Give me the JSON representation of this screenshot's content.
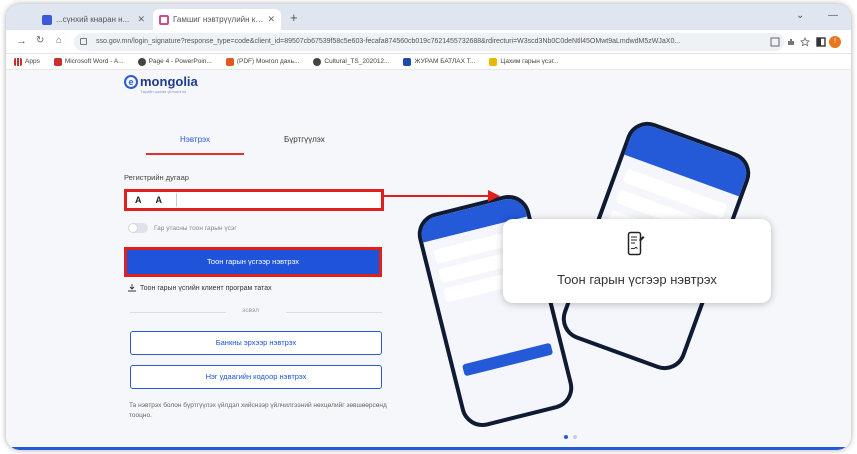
{
  "browser": {
    "tabs": [
      {
        "label": "...сүнхий кнаран н...",
        "color": "#3b5bd8"
      },
      {
        "label": "Гамшиг нэвтрүүлийн кнаран хэ...",
        "color": "#d14a8b"
      }
    ],
    "new_tab": "+",
    "window_controls": {
      "minimize": "⌄",
      "more": "—"
    },
    "url": "sso.gov.mn/login_signature?response_type=code&client_id=89507cb67539f58c5e603-fecafa874560cb019c7621455732688&rdirecturi=W3scd3Nb0C0deNtll45OMwt9aLmdwdM5zWJaX0...",
    "profile_initial": "!"
  },
  "bookmarks": [
    {
      "label": "Apps",
      "color": "#888888"
    },
    {
      "label": "Microsoft Word - A...",
      "color": "#c9302c"
    },
    {
      "label": "Page 4 - PowerPoin...",
      "color": "#444444"
    },
    {
      "label": "(PDF) Монгол дахь...",
      "color": "#e2591e"
    },
    {
      "label": "Cultural_TS_202012...",
      "color": "#444444"
    },
    {
      "label": "ЖУРАМ БАТЛАХ Т...",
      "color": "#1f4aa8"
    },
    {
      "label": "Цахим гарын үсэг...",
      "color": "#e6b800"
    }
  ],
  "logo": {
    "prefix": "e",
    "word": "mongolia",
    "subtitle": "Төрийн цахим үйлчилгээ"
  },
  "login": {
    "tab_login": "Нэвтрэх",
    "tab_register": "Бүртгүүлэх",
    "registry_label": "Регистрийн дугаар",
    "registry_letter1": "А",
    "registry_letter2": "А",
    "toggle_label": "Гар утасны тоон гарын үсэг",
    "sign_button": "Тоон гарын үсгээр нэвтрэх",
    "download_link": "Тоон гарын үсгийн клиент програм татах",
    "or_text": "эсвэл",
    "bank_button": "Банкны эрхээр нэвтрэх",
    "otp_button": "Нэг удаагийн кодоор нэвтрэх",
    "note": "Та нэвтрэх болон бүртгүүлэх үйлдэл хийснээр үйлчилгээний нөхцөлийг зөвшөөрсөнд тооцно."
  },
  "callout": {
    "text": "Тоон гарын үсгээр нэвтрэх",
    "icon": "phone-signature-icon"
  },
  "colors": {
    "accent": "#2459d8",
    "highlight": "#e0201c"
  }
}
